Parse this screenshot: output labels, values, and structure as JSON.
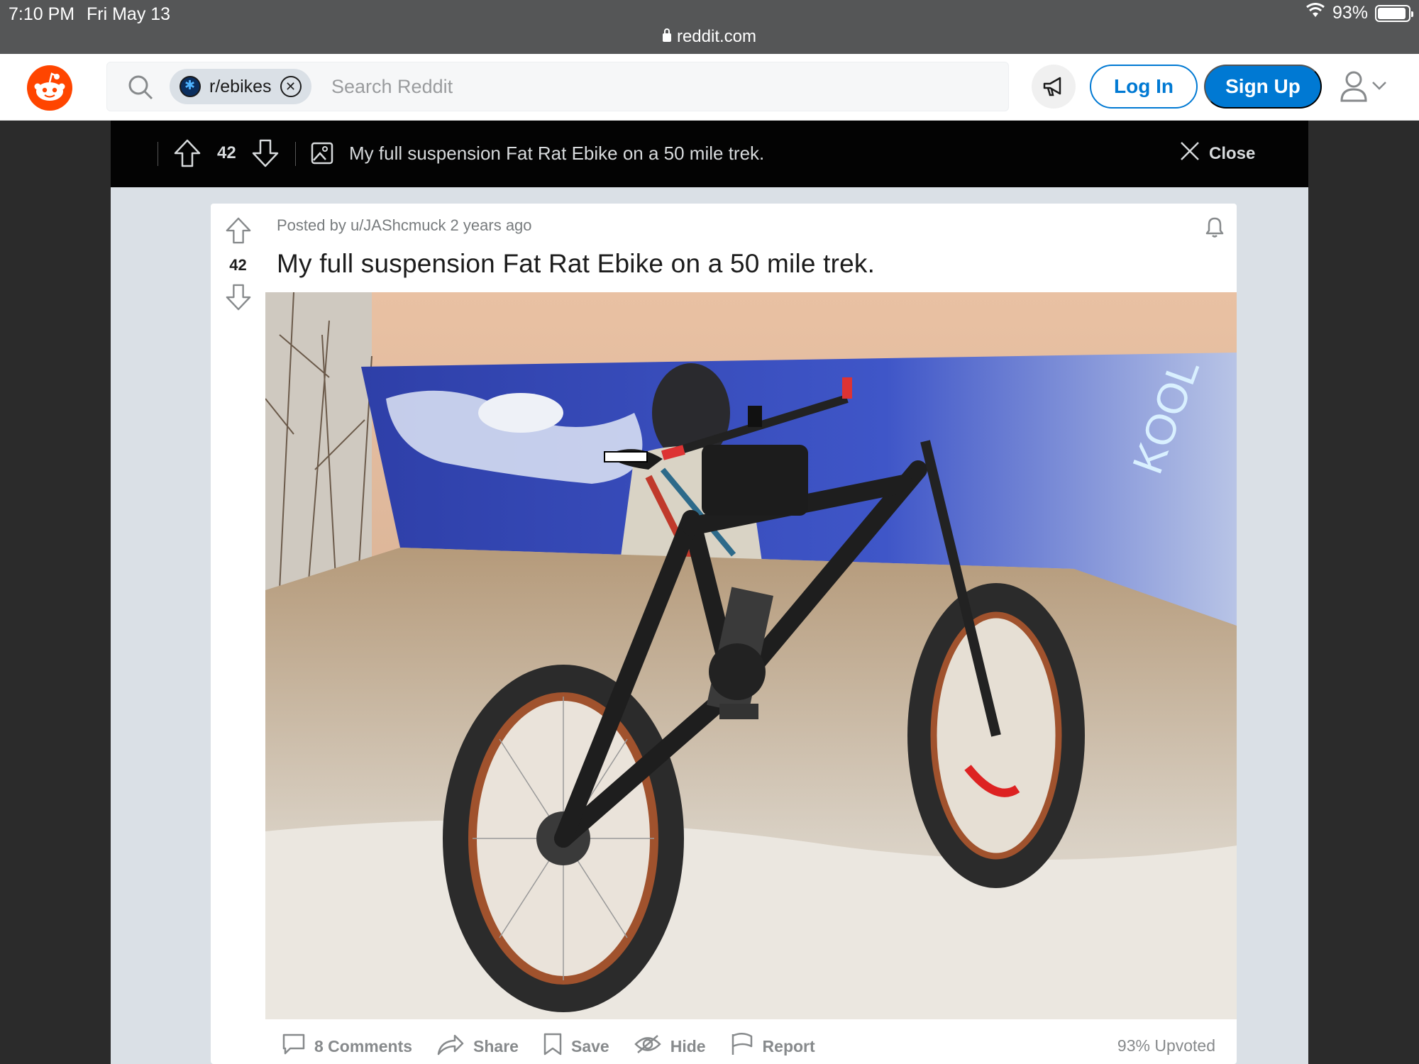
{
  "status_bar": {
    "time": "7:10 PM",
    "date": "Fri May 13",
    "battery": "93%",
    "battery_level": 0.93
  },
  "browser": {
    "url": "reddit.com"
  },
  "header": {
    "community_chip": "r/ebikes",
    "search_placeholder": "Search Reddit",
    "login_label": "Log In",
    "signup_label": "Sign Up"
  },
  "post_topbar": {
    "score": "42",
    "title": "My full suspension Fat Rat Ebike on a 50 mile trek.",
    "close_label": "Close"
  },
  "post": {
    "score": "42",
    "meta": "Posted by u/JAShcmuck 2 years ago",
    "title": "My full suspension Fat Rat Ebike on a 50 mile trek.",
    "actions": {
      "comments": "8 Comments",
      "share": "Share",
      "save": "Save",
      "hide": "Hide",
      "report": "Report"
    },
    "upvoted": "93% Upvoted"
  },
  "colors": {
    "brand": "#ff4500",
    "accent": "#0079d3",
    "overlay_bg": "#dae0e6",
    "topbar_bg": "#030303"
  },
  "icons": [
    "wifi-icon",
    "battery-icon",
    "lock-icon",
    "reddit-logo",
    "search-icon",
    "close-circle-icon",
    "megaphone-icon",
    "user-icon",
    "chevron-down-icon",
    "upvote-icon",
    "downvote-icon",
    "image-icon",
    "close-icon",
    "bell-icon",
    "comment-icon",
    "share-icon",
    "save-icon",
    "hide-icon",
    "report-icon"
  ]
}
